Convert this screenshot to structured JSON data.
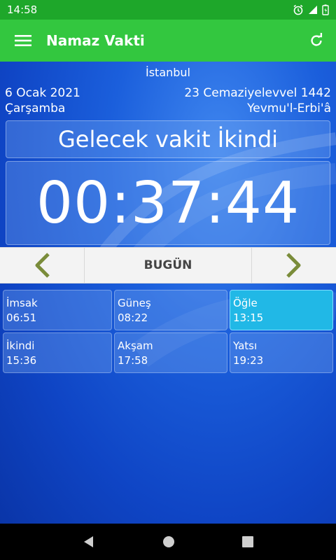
{
  "status": {
    "time": "14:58"
  },
  "app": {
    "title": "Namaz Vakti"
  },
  "location": {
    "city": "İstanbul"
  },
  "dates": {
    "gregorian_date": "6 Ocak 2021",
    "gregorian_day": "Çarşamba",
    "hijri_date": "23 Cemaziyelevvel 1442",
    "hijri_day": "Yevmu'l-Erbi'â"
  },
  "next": {
    "label": "Gelecek vakit İkindi",
    "countdown": "00:37:44"
  },
  "day_nav": {
    "label": "BUGÜN"
  },
  "times": [
    {
      "name": "İmsak",
      "time": "06:51"
    },
    {
      "name": "Güneş",
      "time": "08:22"
    },
    {
      "name": "Öğle",
      "time": "13:15"
    },
    {
      "name": "İkindi",
      "time": "15:36"
    },
    {
      "name": "Akşam",
      "time": "17:58"
    },
    {
      "name": "Yatsı",
      "time": "19:23"
    }
  ],
  "colors": {
    "status_bar": "#1ea72a",
    "app_bar": "#33c73f",
    "active_cell": "#21b8e6",
    "arrow": "#7a8c3a"
  }
}
